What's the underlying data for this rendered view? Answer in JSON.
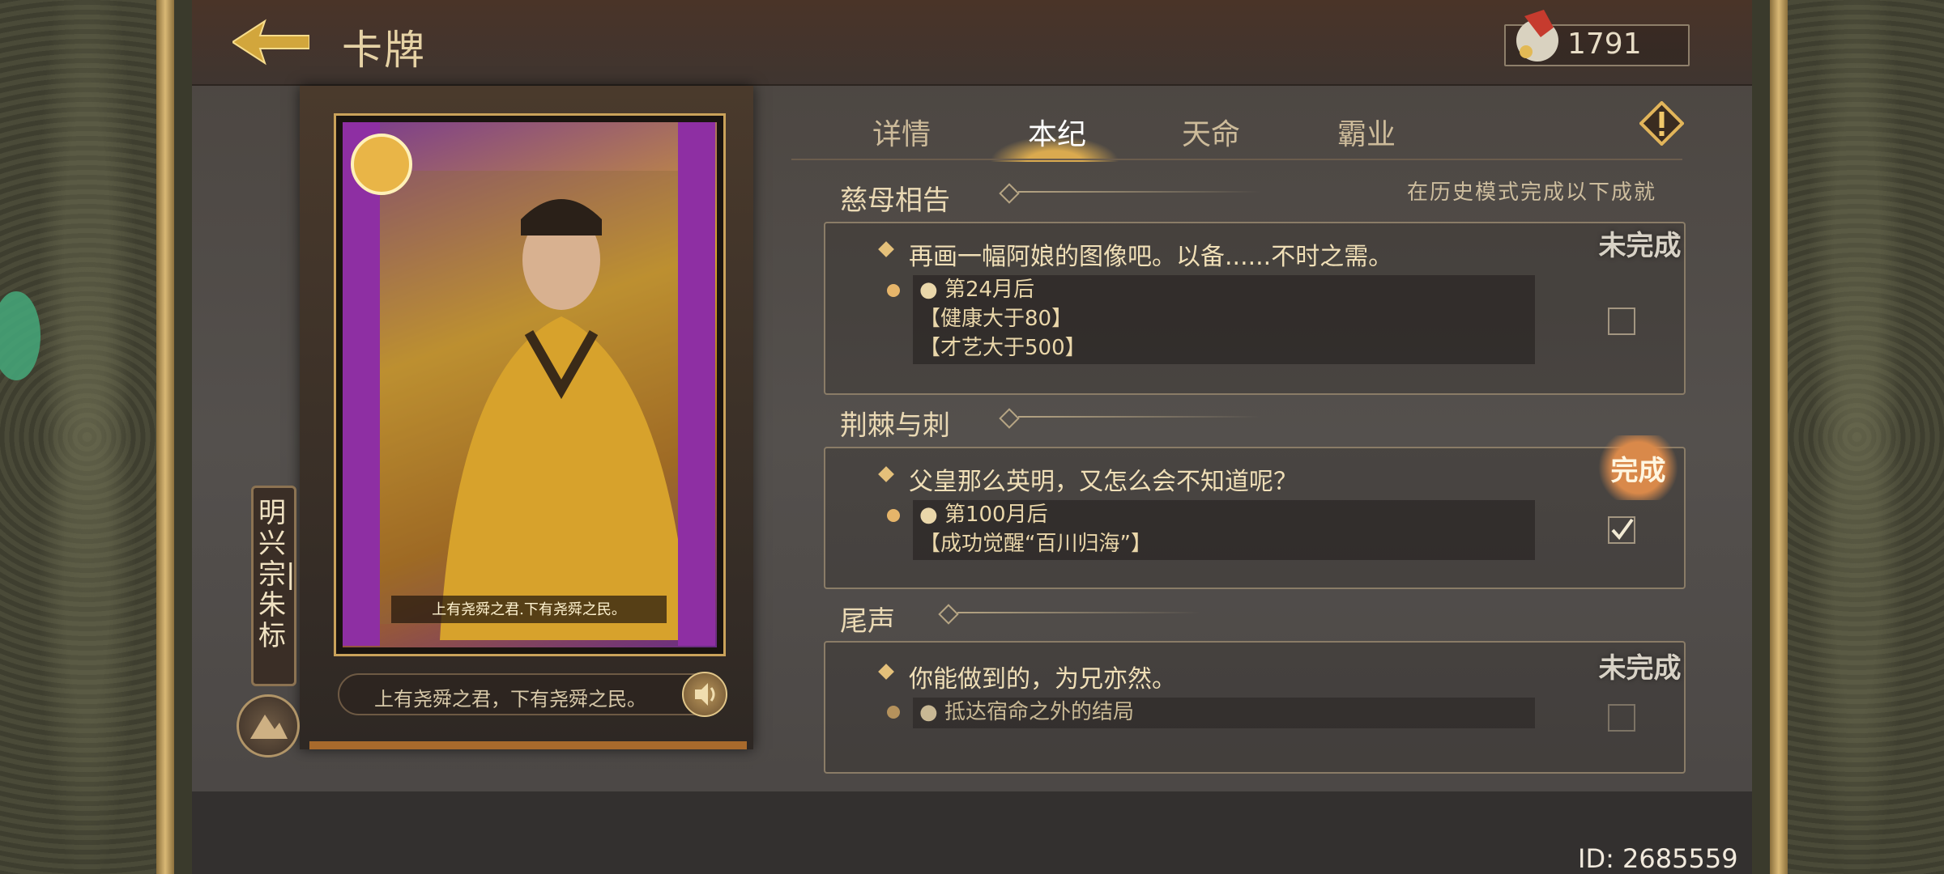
{
  "header": {
    "title": "卡牌",
    "currency_value": "1791"
  },
  "card": {
    "name": "明兴宗|朱标",
    "inner_caption": "上有尧舜之君.下有尧舜之民。",
    "quote": "上有尧舜之君，下有尧舜之民。"
  },
  "tabs": [
    {
      "label": "详情"
    },
    {
      "label": "本纪"
    },
    {
      "label": "天命"
    },
    {
      "label": "霸业"
    }
  ],
  "history_note": "在历史模式完成以下成就",
  "sections": [
    {
      "title": "慈母相告",
      "quest": "再画一幅阿娘的图像吧。以备......不时之需。",
      "conditions": [
        "● 第24月后",
        "【健康大于80】",
        "【才艺大于500】"
      ],
      "status": "未完成",
      "checked": false
    },
    {
      "title": "荆棘与刺",
      "quest": "父皇那么英明，又怎么会不知道呢？",
      "conditions": [
        "● 第100月后",
        "【成功觉醒“百川归海”】"
      ],
      "status": "完成",
      "checked": true
    },
    {
      "title": "尾声",
      "quest": "你能做到的，为兄亦然。",
      "conditions": [
        "● 抵达宿命之外的结局"
      ],
      "status": "未完成",
      "checked": false
    }
  ],
  "footer": {
    "id_text": "ID: 2685559"
  },
  "colors": {
    "accent_gold": "#e4c07a",
    "text_cream": "#f0dfb7",
    "done_stamp": "#d9894a"
  }
}
